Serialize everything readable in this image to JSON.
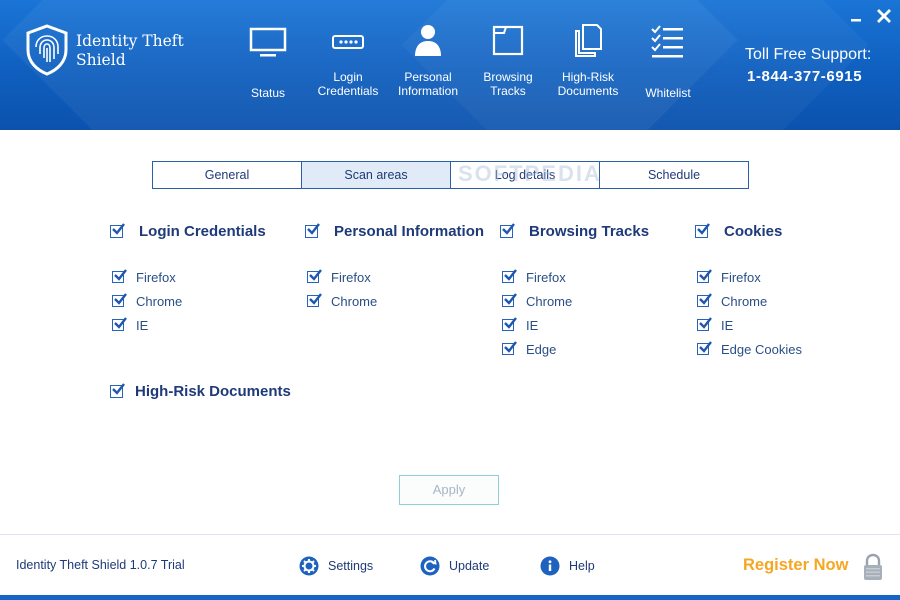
{
  "app": {
    "name": "Identity Theft Shield",
    "version_text": "Identity Theft Shield 1.0.7 Trial"
  },
  "header": {
    "nav": [
      {
        "label": "Status",
        "icon": "monitor-icon"
      },
      {
        "label": "Login\nCredentials",
        "icon": "password-field-icon"
      },
      {
        "label": "Personal\nInformation",
        "icon": "person-icon"
      },
      {
        "label": "Browsing\nTracks",
        "icon": "browser-window-icon"
      },
      {
        "label": "High-Risk\nDocuments",
        "icon": "documents-icon"
      },
      {
        "label": "Whitelist",
        "icon": "checklist-icon"
      }
    ],
    "support_label": "Toll Free Support:",
    "support_phone": "1-844-377-6915"
  },
  "tabs": [
    {
      "label": "General",
      "active": false
    },
    {
      "label": "Scan areas",
      "active": true
    },
    {
      "label": "Log details",
      "active": false
    },
    {
      "label": "Schedule",
      "active": false
    }
  ],
  "watermark": "SOFTPEDIA",
  "scan_groups": [
    {
      "title": "Login Credentials",
      "checked": true,
      "items": [
        {
          "label": "Firefox",
          "checked": true
        },
        {
          "label": "Chrome",
          "checked": true
        },
        {
          "label": "IE",
          "checked": true
        }
      ]
    },
    {
      "title": "Personal Information",
      "checked": true,
      "items": [
        {
          "label": "Firefox",
          "checked": true
        },
        {
          "label": "Chrome",
          "checked": true
        }
      ]
    },
    {
      "title": "Browsing Tracks",
      "checked": true,
      "items": [
        {
          "label": "Firefox",
          "checked": true
        },
        {
          "label": "Chrome",
          "checked": true
        },
        {
          "label": "IE",
          "checked": true
        },
        {
          "label": "Edge",
          "checked": true
        }
      ]
    },
    {
      "title": "Cookies",
      "checked": true,
      "items": [
        {
          "label": "Firefox",
          "checked": true
        },
        {
          "label": "Chrome",
          "checked": true
        },
        {
          "label": "IE",
          "checked": true
        },
        {
          "label": "Edge Cookies",
          "checked": true
        }
      ]
    }
  ],
  "high_risk": {
    "title": "High-Risk Documents",
    "checked": true
  },
  "apply_label": "Apply",
  "footer": {
    "settings_label": "Settings",
    "update_label": "Update",
    "help_label": "Help",
    "register_label": "Register Now"
  },
  "colors": {
    "header_blue": "#1565c8",
    "text_navy": "#1e3a78",
    "checkbox_blue": "#2564b8",
    "register_orange": "#f5a623",
    "apply_border": "#8fd0d6"
  }
}
